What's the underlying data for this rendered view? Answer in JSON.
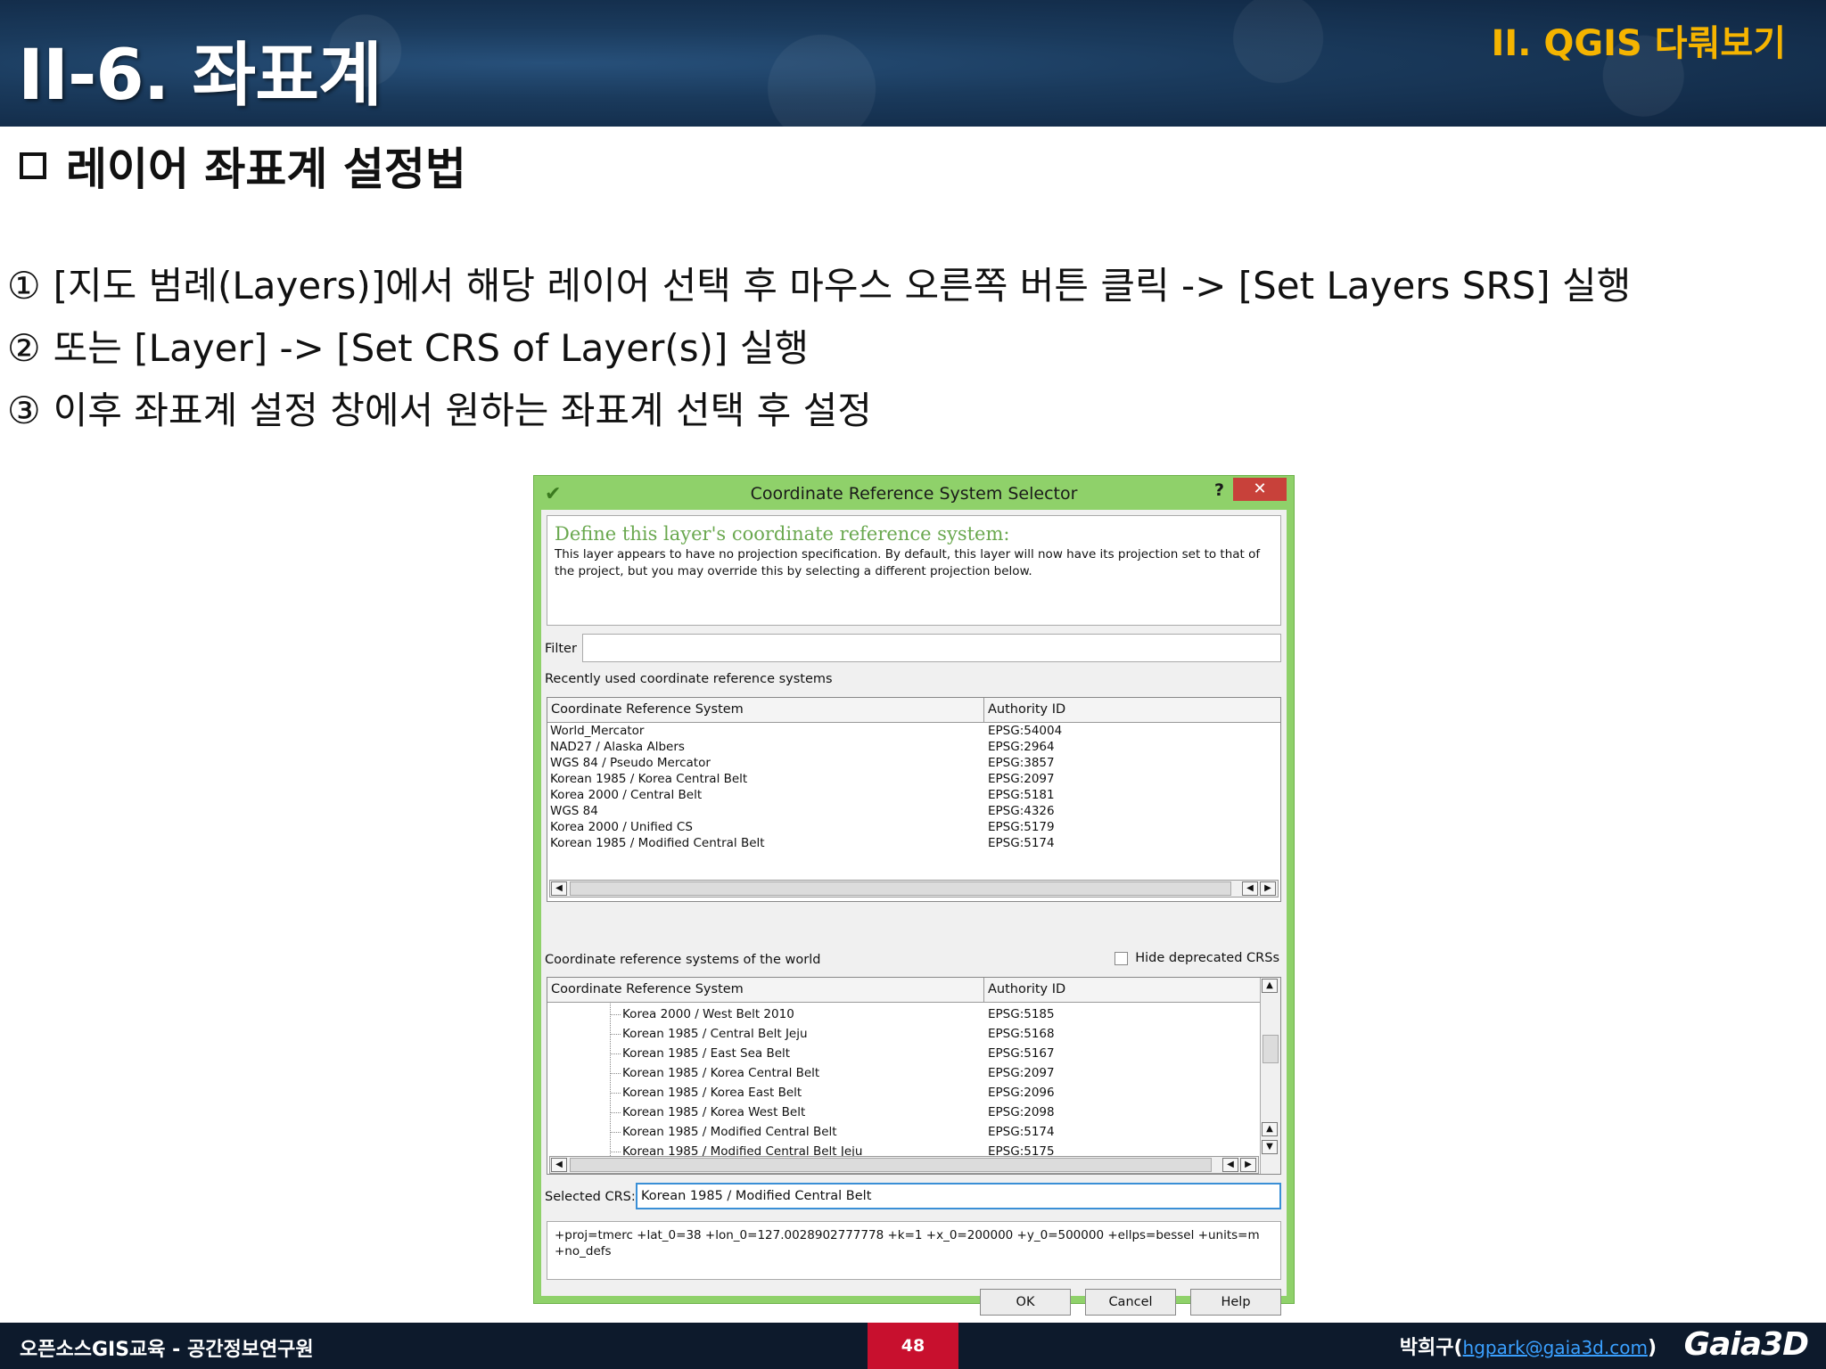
{
  "header": {
    "title": "II-6. 좌표계",
    "section": "II. QGIS 다뤄보기"
  },
  "subtitle": "레이어 좌표계 설정법",
  "steps": [
    {
      "num": "①",
      "text": "[지도 범례(Layers)]에서 해당 레이어 선택 후 마우스 오른쪽 버튼 클릭 -> [Set Layers SRS] 실행"
    },
    {
      "num": "②",
      "text": "또는 [Layer] -> [Set CRS of Layer(s)] 실행"
    },
    {
      "num": "③",
      "text": "이후 좌표계 설정 창에서 원하는 좌표계 선택 후 설정"
    }
  ],
  "dialog": {
    "title": "Coordinate Reference System Selector",
    "help": "?",
    "close": "✕",
    "description_heading": "Define this layer's coordinate reference system:",
    "description_text": "This layer appears to have no projection specification. By default, this layer will now have its projection set to that of the project, but you may override this by selecting a different projection below.",
    "filter_label": "Filter",
    "filter_value": "",
    "recent_label": "Recently used coordinate reference systems",
    "col_crs": "Coordinate Reference System",
    "col_authority": "Authority ID",
    "recent_rows": [
      {
        "name": "World_Mercator",
        "id": "EPSG:54004"
      },
      {
        "name": "NAD27 / Alaska Albers",
        "id": "EPSG:2964"
      },
      {
        "name": "WGS 84 / Pseudo Mercator",
        "id": "EPSG:3857"
      },
      {
        "name": "Korean 1985 / Korea Central Belt",
        "id": "EPSG:2097"
      },
      {
        "name": "Korea 2000 / Central Belt",
        "id": "EPSG:5181"
      },
      {
        "name": "WGS 84",
        "id": "EPSG:4326"
      },
      {
        "name": "Korea 2000 / Unified CS",
        "id": "EPSG:5179"
      },
      {
        "name": "Korean 1985 / Modified Central Belt",
        "id": "EPSG:5174"
      }
    ],
    "world_label": "Coordinate reference systems of the world",
    "hide_deprecated": "Hide deprecated CRSs",
    "world_rows": [
      {
        "name": "Korea 2000 / West Belt 2010",
        "id": "EPSG:5185"
      },
      {
        "name": "Korean 1985 / Central Belt Jeju",
        "id": "EPSG:5168"
      },
      {
        "name": "Korean 1985 / East Sea Belt",
        "id": "EPSG:5167"
      },
      {
        "name": "Korean 1985 / Korea Central Belt",
        "id": "EPSG:2097"
      },
      {
        "name": "Korean 1985 / Korea East Belt",
        "id": "EPSG:2096"
      },
      {
        "name": "Korean 1985 / Korea West Belt",
        "id": "EPSG:2098"
      },
      {
        "name": "Korean 1985 / Modified Central Belt",
        "id": "EPSG:5174"
      },
      {
        "name": "Korean 1985 / Modified Central Belt Jeju",
        "id": "EPSG:5175"
      }
    ],
    "selected_label": "Selected CRS:",
    "selected_value": "Korean 1985 / Modified Central Belt",
    "proj_string": "+proj=tmerc +lat_0=38 +lon_0=127.0028902777778 +k=1 +x_0=200000 +y_0=500000 +ellps=bessel +units=m +no_defs",
    "ok": "OK",
    "cancel": "Cancel",
    "help_button": "Help"
  },
  "footer": {
    "org": "오픈소스GIS교육 - 공간정보연구원",
    "page": "48",
    "author": "박희구(",
    "email": "hgpark@gaia3d.com",
    "author_close": ")",
    "logo": "Gaia3D"
  },
  "colors": {
    "accent": "#f5b400",
    "dialog_frame": "#8fd16a",
    "page_badge": "#c8102e",
    "header_bg": "#1a3a5c",
    "footer_bg": "#0d1a2c"
  }
}
